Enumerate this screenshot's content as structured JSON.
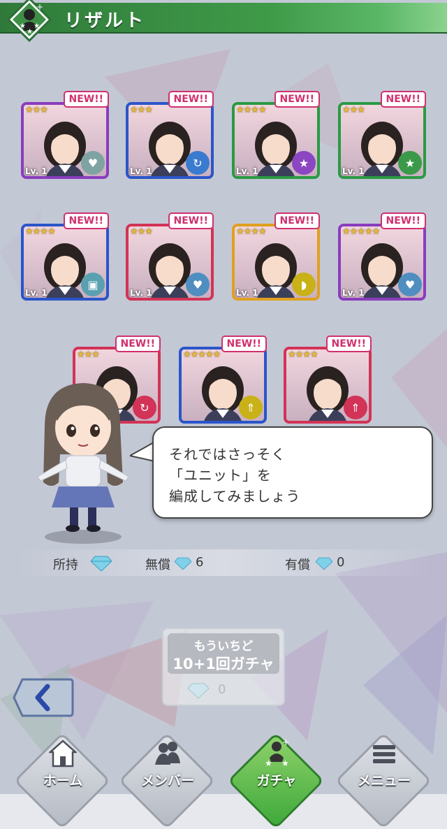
{
  "header": {
    "title": "リザルト"
  },
  "cards": [
    {
      "new": "NEW!!",
      "stars": "★★★",
      "level": "Lv. 1",
      "frame": "#8a3dbd",
      "attr": "heart",
      "attrColor": "#7fa3a3"
    },
    {
      "new": "NEW!!",
      "stars": "★★★",
      "level": "Lv. 1",
      "frame": "#2b55c9",
      "attr": "cycle",
      "attrColor": "#3a7bd0"
    },
    {
      "new": "NEW!!",
      "stars": "★★★★",
      "level": "Lv. 1",
      "frame": "#2a9a44",
      "attr": "star",
      "attrColor": "#8c46c2"
    },
    {
      "new": "NEW!!",
      "stars": "★★★",
      "level": "Lv. 1",
      "frame": "#2a9a44",
      "attr": "star",
      "attrColor": "#3a9a4a"
    },
    {
      "new": "NEW!!",
      "stars": "★★★★",
      "level": "Lv. 1",
      "frame": "#2b55c9",
      "attr": "square",
      "attrColor": "#5aa0b0"
    },
    {
      "new": "NEW!!",
      "stars": "★★★",
      "level": "Lv. 1",
      "frame": "#d23357",
      "attr": "heart",
      "attrColor": "#4f8ec0"
    },
    {
      "new": "NEW!!",
      "stars": "★★★★",
      "level": "Lv. 1",
      "frame": "#e0a020",
      "attr": "drop",
      "attrColor": "#c8b218"
    },
    {
      "new": "NEW!!",
      "stars": "★★★★★",
      "level": "Lv. 1",
      "frame": "#8a3dbd",
      "attr": "heart",
      "attrColor": "#4f8ec0"
    },
    {
      "new": "NEW!!",
      "stars": "★★★",
      "level": "",
      "frame": "#d23357",
      "attr": "cycle",
      "attrColor": "#d23357"
    },
    {
      "new": "NEW!!",
      "stars": "★★★★★",
      "level": "",
      "frame": "#2b55c9",
      "attr": "up",
      "attrColor": "#c8b218"
    },
    {
      "new": "NEW!!",
      "stars": "★★★★",
      "level": "",
      "frame": "#d23357",
      "attr": "up",
      "attrColor": "#d23357"
    }
  ],
  "bubble": {
    "line1": "それではさっそく",
    "line2": "「ユニット」を",
    "line3": "編成してみましょう"
  },
  "currency": {
    "owned_label": "所持",
    "free_label": "無償",
    "free_value": "6",
    "paid_label": "有償",
    "paid_value": "0"
  },
  "retry": {
    "line1": "もういちど",
    "line2": "10+1回ガチャ",
    "cost": "0"
  },
  "nav": {
    "items": [
      {
        "label": "ホーム",
        "icon": "home-icon"
      },
      {
        "label": "メンバー",
        "icon": "members-icon"
      },
      {
        "label": "ガチャ",
        "icon": "gacha-icon"
      },
      {
        "label": "メニュー",
        "icon": "menu-icon"
      }
    ]
  },
  "colors": {
    "header_green": "#3f9a48",
    "new_badge": "#d0306e",
    "gem": "#7fd0e8",
    "nav_active": "#3ea93a"
  }
}
